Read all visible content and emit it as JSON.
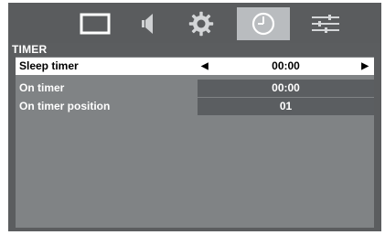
{
  "menu": {
    "tabs": [
      {
        "icon": "picture-icon",
        "active": false
      },
      {
        "icon": "speaker-icon",
        "active": false
      },
      {
        "icon": "gear-icon",
        "active": false
      },
      {
        "icon": "clock-icon",
        "active": true
      },
      {
        "icon": "sliders-icon",
        "active": false
      }
    ]
  },
  "section": {
    "title": "TIMER"
  },
  "rows": [
    {
      "label": "Sleep timer",
      "value": "00:00",
      "selected": true,
      "has_arrows": true
    },
    {
      "label": "On timer",
      "value": "00:00",
      "selected": false,
      "has_arrows": false
    },
    {
      "label": "On timer position",
      "value": "01",
      "selected": false,
      "has_arrows": false
    }
  ],
  "arrows": {
    "left": "◀",
    "right": "▶"
  },
  "colors": {
    "background": "#5b5d5f",
    "content": "#808385",
    "value_area": "#5b5e61",
    "active_tab": "#b9bcbf",
    "highlight": "#ffffff"
  }
}
